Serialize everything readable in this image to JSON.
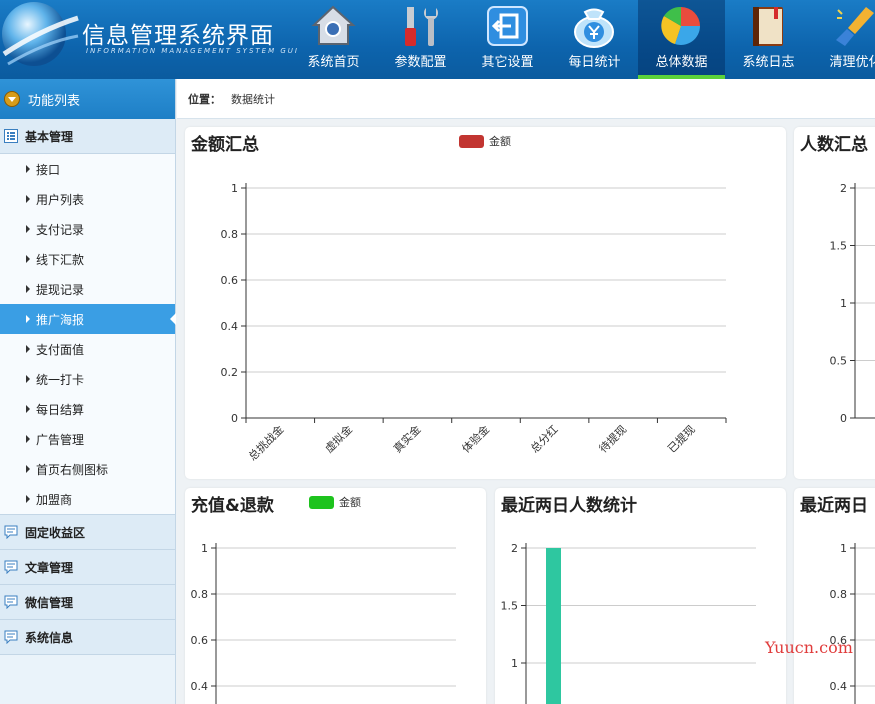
{
  "header": {
    "title": "信息管理系统界面",
    "subtitle": "INFORMATION MANAGEMENT SYSTEM GUI",
    "nav": [
      {
        "label": "系统首页",
        "icon": "home-icon"
      },
      {
        "label": "参数配置",
        "icon": "tools-icon"
      },
      {
        "label": "其它设置",
        "icon": "exit-icon"
      },
      {
        "label": "每日统计",
        "icon": "money-bag-icon"
      },
      {
        "label": "总体数据",
        "icon": "pie-chart-icon",
        "active": true
      },
      {
        "label": "系统日志",
        "icon": "book-icon"
      },
      {
        "label": "清理优化",
        "icon": "brush-icon"
      }
    ]
  },
  "sidebar": {
    "title": "功能列表",
    "group_basic": "基本管理",
    "items": [
      "接口",
      "用户列表",
      "支付记录",
      "线下汇款",
      "提现记录",
      "推广海报",
      "支付面值",
      "统一打卡",
      "每日结算",
      "广告管理",
      "首页右侧图标",
      "加盟商"
    ],
    "active_item": "推广海报",
    "groups": [
      "固定收益区",
      "文章管理",
      "微信管理",
      "系统信息"
    ]
  },
  "breadcrumb": {
    "label": "位置：",
    "value": "数据统计"
  },
  "colors": {
    "red_series": "#c23531",
    "green_series": "#1ec31e",
    "teal_bar": "#2ec7a0",
    "accent": "#3a9ee4"
  },
  "panels": {
    "amount": {
      "title": "金额汇总",
      "legend": "金额"
    },
    "people": {
      "title": "人数汇总"
    },
    "recharge": {
      "title": "充值&退款",
      "legend": "金额"
    },
    "recent_people": {
      "title": "最近两日人数统计"
    },
    "recent_other": {
      "title": "最近两日"
    }
  },
  "watermark": "Yuucn.com",
  "chart_data": [
    {
      "id": "amount",
      "type": "bar",
      "title": "金额汇总",
      "categories": [
        "总挑战金",
        "虚拟金",
        "真实金",
        "体验金",
        "总分红",
        "待提现",
        "已提现"
      ],
      "series": [
        {
          "name": "金额",
          "values": [
            0,
            0,
            0,
            0,
            0,
            0,
            0
          ]
        }
      ],
      "yticks": [
        "0",
        "0.2",
        "0.4",
        "0.6",
        "0.8",
        "1"
      ],
      "ylim": [
        0,
        1
      ],
      "grid": true
    },
    {
      "id": "people",
      "type": "bar",
      "title": "人数汇总",
      "yticks": [
        "0",
        "0.5",
        "1",
        "1.5",
        "2"
      ],
      "ylim": [
        0,
        2
      ],
      "grid": true
    },
    {
      "id": "recharge",
      "type": "bar",
      "title": "充值&退款",
      "series": [
        {
          "name": "金额",
          "values": []
        }
      ],
      "yticks": [
        "0.4",
        "0.6",
        "0.8",
        "1"
      ],
      "ylim": [
        0,
        1
      ],
      "grid": true
    },
    {
      "id": "recent_people",
      "type": "bar",
      "title": "最近两日人数统计",
      "yticks": [
        "1",
        "1.5",
        "2"
      ],
      "ylim": [
        0,
        2
      ],
      "first_bar_value": 2,
      "grid": true
    },
    {
      "id": "recent_other",
      "type": "bar",
      "title": "最近两日",
      "yticks": [
        "0.4",
        "0.6",
        "0.8",
        "1"
      ],
      "ylim": [
        0,
        1
      ],
      "grid": true
    }
  ]
}
